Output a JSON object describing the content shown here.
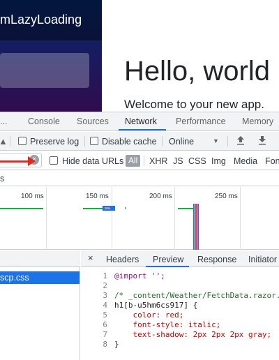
{
  "app": {
    "brand": "mLazyLoading",
    "heading": "Hello, world",
    "subheading": "Welcome to your new app."
  },
  "devtools": {
    "tabs": [
      "...",
      "Console",
      "Sources",
      "Network",
      "Performance",
      "Memory"
    ],
    "active_tab": "Network",
    "toolbar": {
      "preserve_log": "Preserve log",
      "disable_cache": "Disable cache",
      "throttle": "Online",
      "throttle_arrow": "▼",
      "import_icon": "upload-icon",
      "export_icon": "download-icon"
    },
    "filter": {
      "hide_data_urls": "Hide data URLs",
      "types": [
        "All",
        "XHR",
        "JS",
        "CSS",
        "Img",
        "Media",
        "Fon"
      ]
    },
    "row_s": "s",
    "overview": {
      "ticks": [
        "100 ms",
        "150 ms",
        "200 ms",
        "250 ms"
      ],
      "colors": {
        "green": "#1fa844",
        "blue": "#1a73e8",
        "red": "#d93025",
        "purple": "#9334e6"
      }
    },
    "request_list": {
      "selected": "scp.css"
    },
    "detail": {
      "close": "×",
      "tabs": [
        "Headers",
        "Preview",
        "Response",
        "Initiator"
      ],
      "active_tab": "Preview",
      "code": [
        {
          "n": "1",
          "text": "@import '';"
        },
        {
          "n": "2",
          "text": ""
        },
        {
          "n": "3",
          "text": "/* _content/Weather/FetchData.razor.rz.scp.css */"
        },
        {
          "n": "4",
          "text": "h1[b-u5hm6cs917] {"
        },
        {
          "n": "5",
          "text": "    color: red;"
        },
        {
          "n": "6",
          "text": "    font-style: italic;"
        },
        {
          "n": "7",
          "text": "    text-shadow: 2px 2px 2px gray;"
        },
        {
          "n": "8",
          "text": "}"
        }
      ]
    }
  }
}
